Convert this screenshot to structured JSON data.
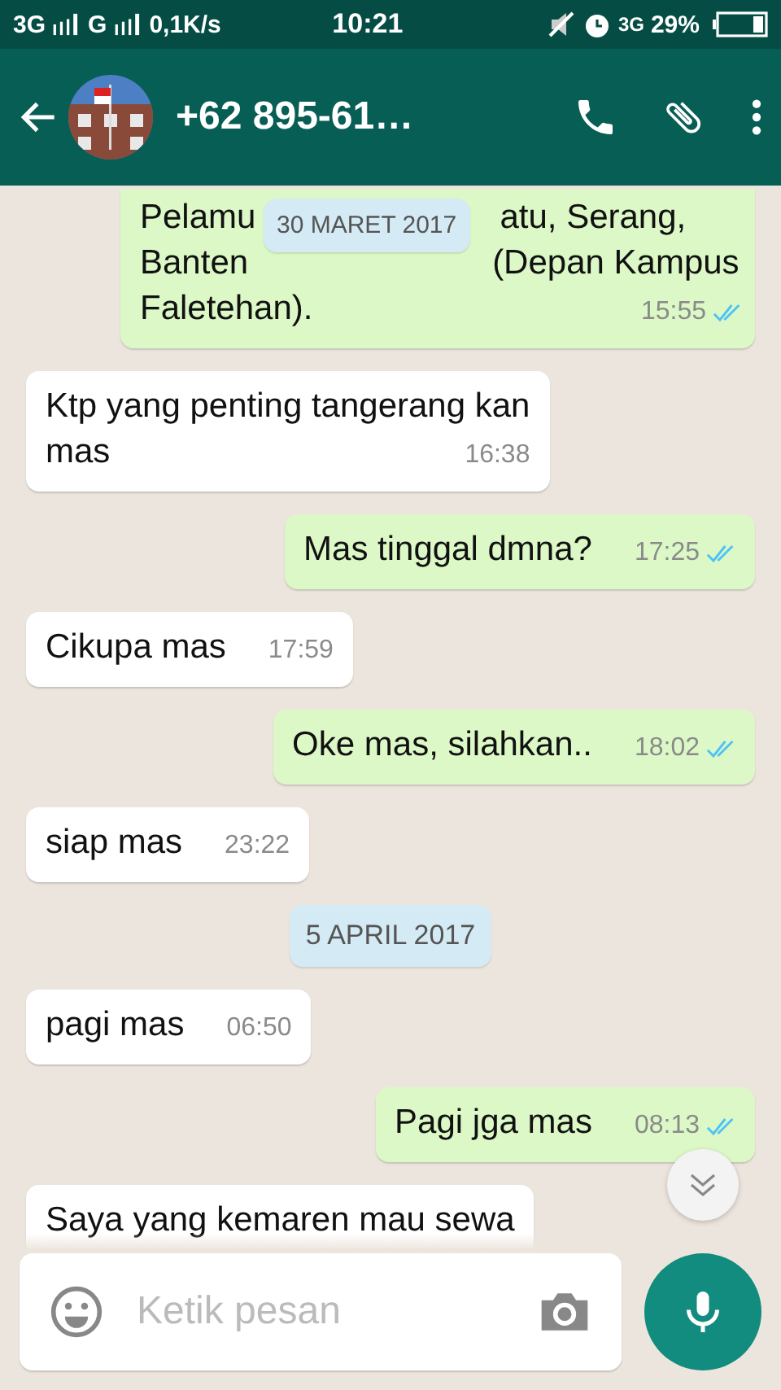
{
  "status_bar": {
    "left": [
      "3G",
      "G"
    ],
    "speed": "0,1K/s",
    "time": "10:21",
    "network": "3G",
    "battery": "29%"
  },
  "header": {
    "title": "+62 895-61…"
  },
  "messages": [
    {
      "kind": "out",
      "lines": [
        [
          "Pelamu",
          "atu, Serang,"
        ],
        [
          "Banten",
          "(Depan Kampus"
        ],
        [
          "Faletehan)."
        ]
      ],
      "time": "15:55",
      "read": true,
      "overlay_date": "30 MARET 2017"
    },
    {
      "kind": "in",
      "lines": [
        [
          "Ktp yang penting tangerang kan"
        ],
        [
          "mas"
        ]
      ],
      "time": "16:38"
    },
    {
      "kind": "out",
      "lines": [
        [
          "Mas tinggal dmna?"
        ]
      ],
      "time": "17:25",
      "read": true
    },
    {
      "kind": "in",
      "lines": [
        [
          "Cikupa mas"
        ]
      ],
      "time": "17:59"
    },
    {
      "kind": "out",
      "lines": [
        [
          "Oke mas, silahkan.."
        ]
      ],
      "time": "18:02",
      "read": true
    },
    {
      "kind": "in",
      "lines": [
        [
          "siap mas"
        ]
      ],
      "time": "23:22"
    },
    {
      "kind": "date",
      "text": "5 APRIL 2017"
    },
    {
      "kind": "in",
      "lines": [
        [
          "pagi mas"
        ]
      ],
      "time": "06:50"
    },
    {
      "kind": "out",
      "lines": [
        [
          "Pagi jga mas"
        ]
      ],
      "time": "08:13",
      "read": true
    },
    {
      "kind": "in",
      "lines": [
        [
          "Saya yang kemaren mau sewa"
        ]
      ]
    }
  ],
  "composer": {
    "placeholder": "Ketik pesan"
  }
}
